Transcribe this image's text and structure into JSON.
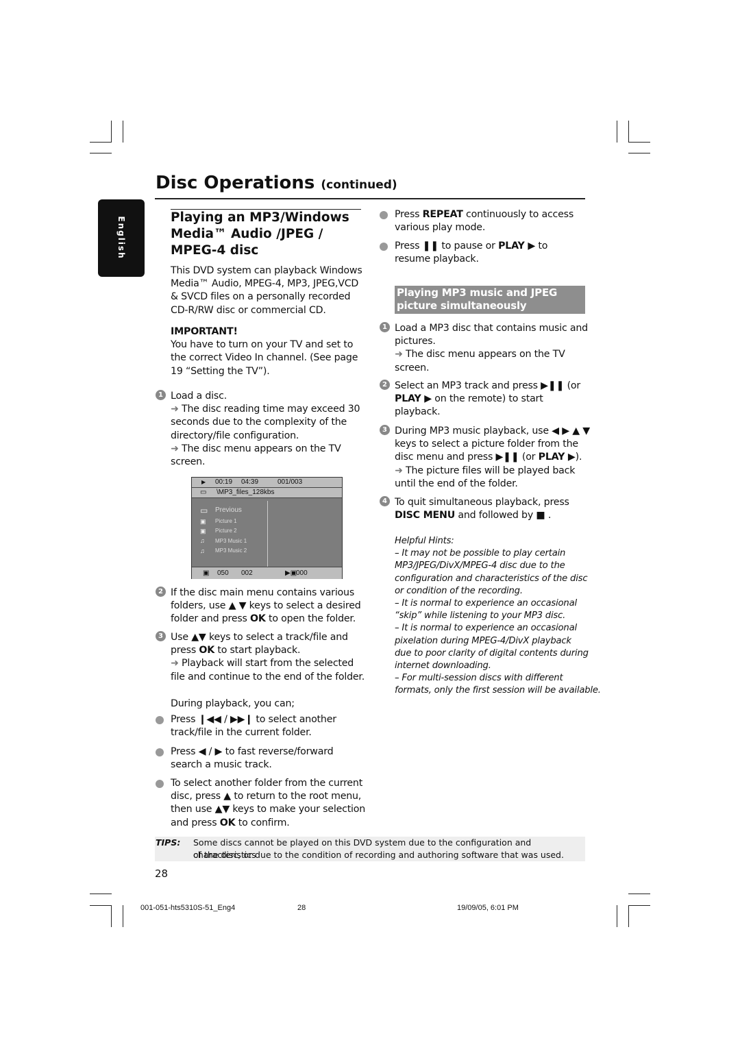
{
  "header": {
    "title": "Disc Operations",
    "title_suffix": "(continued)",
    "language_tab": "English"
  },
  "left": {
    "heading": [
      "Playing an MP3/Windows",
      "Media™ Audio /JPEG /",
      "MPEG-4 disc"
    ],
    "intro": [
      [
        [
          "This DVD system can playback Windows",
          ""
        ]
      ],
      [
        [
          "Media™ Audio, MPEG-4, MP3, JPEG,VCD",
          ""
        ]
      ],
      [
        [
          "& SVCD files on a personally recorded",
          ""
        ]
      ],
      [
        [
          "CD-R/RW disc or commercial CD.",
          ""
        ]
      ]
    ],
    "important": [
      [
        [
          "IMPORTANT!",
          "b"
        ]
      ],
      [
        [
          "You have to turn on your TV and set to",
          ""
        ]
      ],
      [
        [
          "the correct Video In channel.  (See page",
          ""
        ]
      ],
      [
        [
          "19 “Setting the TV”).",
          ""
        ]
      ]
    ],
    "step1": [
      [
        [
          "Load a disc.",
          ""
        ]
      ],
      [
        [
          "➜ ",
          "a"
        ],
        [
          "The disc reading time may exceed 30",
          ""
        ]
      ],
      [
        [
          "seconds due to the complexity of the",
          ""
        ]
      ],
      [
        [
          "directory/file configuration.",
          ""
        ]
      ],
      [
        [
          "➜ ",
          "a"
        ],
        [
          "The disc menu appears on the TV",
          ""
        ]
      ],
      [
        [
          "screen.",
          ""
        ]
      ]
    ],
    "step2": [
      [
        [
          "If the disc main menu contains various",
          ""
        ]
      ],
      [
        [
          "folders, use ▲ ▼ keys to select a desired",
          ""
        ]
      ],
      [
        [
          "folder and press ",
          ""
        ],
        [
          "OK",
          "b"
        ],
        [
          " to open the folder.",
          ""
        ]
      ]
    ],
    "step3": [
      [
        [
          "Use ▲▼ keys to select a track/file and",
          ""
        ]
      ],
      [
        [
          "press ",
          ""
        ],
        [
          "OK",
          "b"
        ],
        [
          " to start playback.",
          ""
        ]
      ],
      [
        [
          "➜ ",
          "a"
        ],
        [
          "Playback will start from the selected",
          ""
        ]
      ],
      [
        [
          "file and continue to the end of the folder.",
          ""
        ]
      ]
    ],
    "during": [
      [
        [
          "During playback, you can;",
          ""
        ]
      ]
    ],
    "bullet1": [
      [
        [
          "Press ❙◀◀ / ▶▶❙ to select another",
          ""
        ]
      ],
      [
        [
          "track/file in the current folder.",
          ""
        ]
      ]
    ],
    "bullet2": [
      [
        [
          "Press ◀ / ▶  to fast reverse/forward",
          ""
        ]
      ],
      [
        [
          "search a music track.",
          ""
        ]
      ]
    ],
    "bullet3": [
      [
        [
          "To select another folder from the current",
          ""
        ]
      ],
      [
        [
          "disc, press ▲ to return to the root menu,",
          ""
        ]
      ],
      [
        [
          "then use ▲▼ keys to make your selection",
          ""
        ]
      ],
      [
        [
          "and press ",
          ""
        ],
        [
          "OK",
          "b"
        ],
        [
          " to confirm.",
          ""
        ]
      ]
    ]
  },
  "screen": {
    "status": [
      "▶",
      "00:19",
      "04:39",
      "001/003"
    ],
    "path": "\\MP3_files_128kbs",
    "items": [
      {
        "icon": "folder",
        "label": "Previous"
      },
      {
        "icon": "picture",
        "label": "Picture 1"
      },
      {
        "icon": "picture",
        "label": "Picture 2"
      },
      {
        "icon": "music",
        "label": "MP3 Music 1"
      },
      {
        "icon": "music",
        "label": "MP3 Music 2"
      }
    ],
    "footer": [
      "050",
      "002",
      "000"
    ]
  },
  "right": {
    "bullet1": [
      [
        [
          "Press ",
          ""
        ],
        [
          "REPEAT",
          "b"
        ],
        [
          " continuously to access",
          ""
        ]
      ],
      [
        [
          "various play mode.",
          ""
        ]
      ]
    ],
    "bullet2": [
      [
        [
          "Press ",
          ""
        ],
        [
          "❚❚",
          "b"
        ],
        [
          " to pause or ",
          ""
        ],
        [
          "PLAY ▶",
          "b"
        ],
        [
          " to",
          ""
        ]
      ],
      [
        [
          "resume playback.",
          ""
        ]
      ]
    ],
    "section": [
      [
        [
          "Playing MP3 music and JPEG",
          ""
        ]
      ],
      [
        [
          "picture simultaneously",
          ""
        ]
      ]
    ],
    "step1": [
      [
        [
          "Load a MP3 disc that contains music and",
          ""
        ]
      ],
      [
        [
          "pictures.",
          ""
        ]
      ],
      [
        [
          "➜ ",
          "a"
        ],
        [
          "The disc menu appears on the TV",
          ""
        ]
      ],
      [
        [
          "screen.",
          ""
        ]
      ]
    ],
    "step2": [
      [
        [
          "Select an MP3 track and press ",
          ""
        ],
        [
          "▶❚❚",
          "b"
        ],
        [
          " (or",
          ""
        ]
      ],
      [
        [
          "PLAY ▶",
          "b"
        ],
        [
          " on the remote) to start",
          ""
        ]
      ],
      [
        [
          "playback.",
          ""
        ]
      ]
    ],
    "step3": [
      [
        [
          "During MP3 music playback, use ◀ ▶ ▲ ▼",
          ""
        ]
      ],
      [
        [
          "keys to select a picture folder from the",
          ""
        ]
      ],
      [
        [
          "disc menu and press ",
          ""
        ],
        [
          "▶❚❚",
          "b"
        ],
        [
          " (or ",
          ""
        ],
        [
          "PLAY ▶",
          "b"
        ],
        [
          ").",
          ""
        ]
      ],
      [
        [
          "➜ ",
          "a"
        ],
        [
          "The picture files will be played back",
          ""
        ]
      ],
      [
        [
          "until the end of the folder.",
          ""
        ]
      ]
    ],
    "step4": [
      [
        [
          "To quit simultaneous playback, press",
          ""
        ]
      ],
      [
        [
          "DISC MENU",
          "b"
        ],
        [
          " and followed by  ■ .",
          ""
        ]
      ]
    ],
    "hints": [
      [
        [
          "Helpful Hints:",
          "i"
        ]
      ],
      [
        [
          "–  It may not be possible to play certain",
          "i"
        ]
      ],
      [
        [
          "MP3/JPEG/DivX/MPEG-4 disc due to the",
          "i"
        ]
      ],
      [
        [
          "configuration and characteristics of the disc",
          "i"
        ]
      ],
      [
        [
          "or condition of the recording.",
          "i"
        ]
      ],
      [
        [
          "–  It is normal to experience an occasional",
          "i"
        ]
      ],
      [
        [
          "“skip” while listening to your MP3 disc.",
          "i"
        ]
      ],
      [
        [
          "–  It is normal to experience an occasional",
          "i"
        ]
      ],
      [
        [
          "pixelation during MPEG-4/DivX playback",
          "i"
        ]
      ],
      [
        [
          "due to poor clarity of digital contents during",
          "i"
        ]
      ],
      [
        [
          "internet downloading.",
          "i"
        ]
      ],
      [
        [
          "–  For multi-session discs with different",
          "i"
        ]
      ],
      [
        [
          "formats, only the first session will be available.",
          "i"
        ]
      ]
    ]
  },
  "step_numbers": [
    "1",
    "2",
    "3",
    "4"
  ],
  "tips": {
    "label": "TIPS:",
    "lines": [
      "Some discs cannot be played on this DVD system due to the configuration and characteristics",
      "of the disc, or due to the condition of recording and authoring software that was used."
    ]
  },
  "page_number": "28",
  "footer": {
    "file": "001-051-hts5310S-51_Eng4",
    "page": "28",
    "date": "19/09/05, 6:01 PM"
  }
}
